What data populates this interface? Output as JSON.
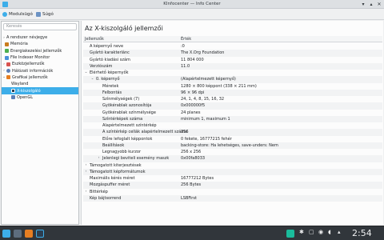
{
  "window": {
    "title": "KInfocenter — Info Center"
  },
  "toolbar": {
    "modules_label": "Modulsügó",
    "help_label": "Súgó"
  },
  "sidebar": {
    "search_placeholder": "Keresés",
    "items": [
      {
        "label": "A rendszer névjegye",
        "expanded": false
      },
      {
        "label": "Memória"
      },
      {
        "label": "Energiakezelési jellemzők"
      },
      {
        "label": "File Indexer Monitor"
      },
      {
        "label": "Eszközjellemzők",
        "collapsed": true
      },
      {
        "label": "Hálózati információk",
        "collapsed": true
      },
      {
        "label": "Grafikai jellemzők",
        "expanded": true
      },
      {
        "label": "Wayland"
      },
      {
        "label": "X-kiszolgáló",
        "selected": true
      },
      {
        "label": "OpenGL"
      }
    ]
  },
  "main": {
    "title": "Az X-kiszolgáló jellemzői",
    "col_property": "Jellemzők",
    "col_value": "Érték",
    "rows": [
      {
        "k": "A képernyő neve",
        "v": ":0"
      },
      {
        "k": "Gyártó karakterlánc",
        "v": "The X.Org Foundation"
      },
      {
        "k": "Gyártó kiadási szám",
        "v": "11 804 000"
      },
      {
        "k": "Verziószám",
        "v": "11.0"
      },
      {
        "k": "Elérhető képernyők",
        "v": ""
      },
      {
        "k": "0. képernyő",
        "v": "(Alapértelmezett képernyő)"
      },
      {
        "k": "Méretek",
        "v": "1280 × 800 képpont (338 × 211 mm)"
      },
      {
        "k": "Felbontás",
        "v": "96 × 96 dpi"
      },
      {
        "k": "Színmélységek (7)",
        "v": "24, 1, 4, 8, 15, 16, 32"
      },
      {
        "k": "Gyökérablak azonosítója",
        "v": "0x000000f5"
      },
      {
        "k": "Gyökérablak színmélysége",
        "v": "24 planes"
      },
      {
        "k": "Színtérképek száma",
        "v": "minimum 1, maximum 1"
      },
      {
        "k": "Alapértelmezett színtérkép",
        "v": ""
      },
      {
        "k": "A színtérkép cellák alapértelmezett száma",
        "v": "256"
      },
      {
        "k": "Előre lefoglalt képpontok",
        "v": "0 fekete, 16777215 fehér"
      },
      {
        "k": "Beállítások",
        "v": "backing-store: Ha lehetséges, save-unders: Nem"
      },
      {
        "k": "Legnagyobb kurzor",
        "v": "256 x 256"
      },
      {
        "k": "Jelenlegi beviteli esemény maszk",
        "v": "0x00fa8033"
      },
      {
        "k": "Támogatott kiterjesztések",
        "v": ""
      },
      {
        "k": "Támogatott képformátumok",
        "v": ""
      },
      {
        "k": "Maximális kérés méret",
        "v": "16777212 Bytes"
      },
      {
        "k": "Mozgáspuffer méret",
        "v": "256 Bytes"
      },
      {
        "k": "Bittérkép",
        "v": ""
      },
      {
        "k": "Kép bájtsorrend",
        "v": "LSBFirst"
      }
    ]
  },
  "taskbar": {
    "clock": "2:54"
  },
  "colors": {
    "accent": "#3daee9",
    "panel": "#31363b"
  }
}
